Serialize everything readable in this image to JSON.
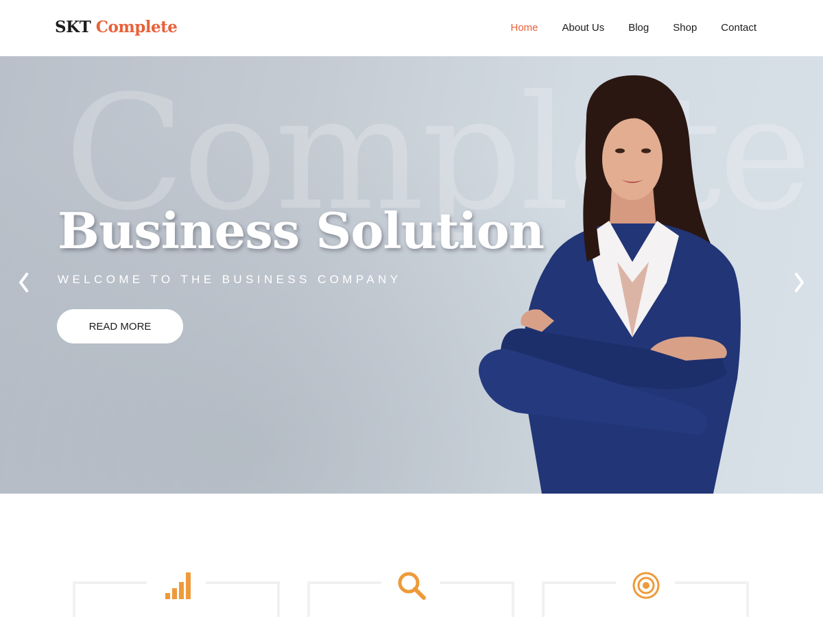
{
  "site": {
    "logo_part1": "SKT",
    "logo_part2": "Complete"
  },
  "nav": {
    "items": [
      {
        "label": "Home",
        "active": true
      },
      {
        "label": "About Us",
        "active": false
      },
      {
        "label": "Blog",
        "active": false
      },
      {
        "label": "Shop",
        "active": false
      },
      {
        "label": "Contact",
        "active": false
      }
    ]
  },
  "hero": {
    "watermark": "Complete",
    "title": "Business Solution",
    "subtitle": "WELCOME TO THE BUSINESS COMPANY",
    "button_label": "READ MORE"
  },
  "icons": {
    "prev": "chevron-left-icon",
    "next": "chevron-right-icon",
    "feature1": "bar-chart-icon",
    "feature2": "search-icon",
    "feature3": "target-icon"
  },
  "colors": {
    "accent": "#e8613b",
    "icon": "#ee9a3a",
    "text": "#1b1b1b"
  }
}
